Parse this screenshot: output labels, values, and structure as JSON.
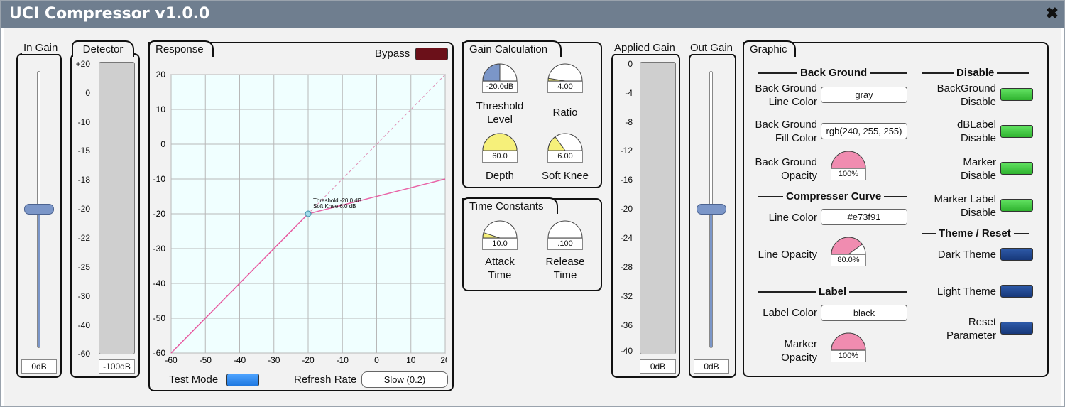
{
  "window": {
    "title": "UCI Compressor v1.0.0",
    "close_icon": "close-icon"
  },
  "in_gain": {
    "label": "In Gain",
    "value": "0dB",
    "level": 0.5
  },
  "detector": {
    "label": "Detector",
    "value": "-100dB",
    "scale": [
      "+20",
      "0",
      "-10",
      "-15",
      "-18",
      "-20",
      "-22",
      "-25",
      "-30",
      "-40",
      "-60"
    ]
  },
  "response": {
    "label": "Response",
    "bypass": "Bypass",
    "test_mode": "Test Mode",
    "refresh_label": "Refresh Rate",
    "refresh_value": "Slow (0.2)",
    "annotation_threshold": "Threshold -20.0 dB",
    "annotation_knee": "Soft Knee  6.0 dB",
    "chart_data": {
      "type": "line",
      "x": [
        -60,
        -20,
        20
      ],
      "y": [
        -60,
        -20,
        -10
      ],
      "xticks": [
        "-60",
        "-50",
        "-40",
        "-30",
        "-20",
        "-10",
        "0",
        "10",
        "20"
      ],
      "yticks": [
        "20",
        "10",
        "0",
        "-10",
        "-20",
        "-30",
        "-40",
        "-50",
        "-60"
      ],
      "xlim": [
        -60,
        20
      ],
      "ylim": [
        -60,
        20
      ],
      "line_color": "#e73f91",
      "bg": "#f0ffff",
      "grid": true
    }
  },
  "gain_calc": {
    "label": "Gain Calculation",
    "threshold": {
      "value": "-20.0dB",
      "label1": "Threshold",
      "label2": "Level",
      "fraction": 0.5,
      "color": "#7b96c8"
    },
    "ratio": {
      "value": "4.00",
      "label": "Ratio",
      "fraction": 0.05,
      "color": "#f6f07a"
    },
    "depth": {
      "value": "60.0",
      "label": "Depth",
      "fraction": 1.0,
      "color": "#f6f07a"
    },
    "knee": {
      "value": "6.00",
      "label": "Soft Knee",
      "fraction": 0.3,
      "color": "#f6f07a"
    }
  },
  "time": {
    "label": "Time Constants",
    "attack": {
      "value": "10.0",
      "label1": "Attack",
      "label2": "Time",
      "fraction": 0.1,
      "color": "#f6f07a"
    },
    "release": {
      "value": ".100",
      "label1": "Release",
      "label2": "Time",
      "fraction": 0.0,
      "color": "#f6f07a"
    }
  },
  "applied_gain": {
    "label": "Applied Gain",
    "value": "0dB",
    "scale": [
      "0",
      "-4",
      "-8",
      "-12",
      "-16",
      "-20",
      "-24",
      "-28",
      "-32",
      "-36",
      "-40"
    ]
  },
  "out_gain": {
    "label": "Out Gain",
    "value": "0dB",
    "level": 0.5
  },
  "graphic": {
    "label": "Graphic",
    "background": "Back Ground",
    "bg_line_color_1": "Back Ground",
    "bg_line_color_2": "Line Color",
    "bg_line_color_value": "gray",
    "bg_fill_color_1": "Back Ground",
    "bg_fill_color_2": "Fill Color",
    "bg_fill_color_value": "rgb(240, 255, 255)",
    "bg_opacity_1": "Back Ground",
    "bg_opacity_2": "Opacity",
    "bg_opacity_value": "100%",
    "bg_opacity_fraction": 1.0,
    "curve": "Compresser Curve",
    "line_color": "Line Color",
    "line_color_value": "#e73f91",
    "line_opacity": "Line Opacity",
    "line_opacity_value": "80.0%",
    "line_opacity_fraction": 0.8,
    "label_section": "Label",
    "label_color": "Label Color",
    "label_color_value": "black",
    "marker_opacity_1": "Marker",
    "marker_opacity_2": "Opacity",
    "marker_opacity_value": "100%",
    "marker_opacity_fraction": 1.0,
    "disable": "Disable",
    "bg_disable_1": "BackGround",
    "bg_disable_2": "Disable",
    "db_disable_1": "dBLabel",
    "db_disable_2": "Disable",
    "marker_disable_1": "Marker",
    "marker_disable_2": "Disable",
    "marker_label_disable_1": "Marker Label",
    "marker_label_disable_2": "Disable",
    "theme_reset": "Theme / Reset",
    "dark_theme": "Dark Theme",
    "light_theme": "Light Theme",
    "reset_1": "Reset",
    "reset_2": "Parameter",
    "knob_color": "#f08cb0"
  }
}
